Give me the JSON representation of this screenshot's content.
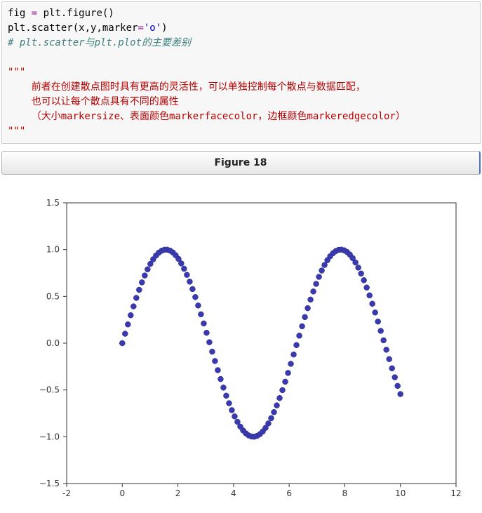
{
  "code": {
    "line1_var": "fig ",
    "line1_op": "=",
    "line1_rest": " plt.figure()",
    "line2_a": "plt.scatter(x,y,marker",
    "line2_op": "=",
    "line2_str": "'o'",
    "line2_close": ")",
    "line3_comment": "# plt.scatter与plt.plot的主要差别",
    "line4_quotes": "\"\"\"",
    "line5": "    前者在创建散点图时具有更高的灵活性，可以单独控制每个散点与数据匹配，",
    "line6": "    也可以让每个散点具有不同的属性",
    "line7": "    （大小markersize、表面颜色markerfacecolor，边框颜色markeredgecolor）",
    "line8_quotes": "\"\"\""
  },
  "figure_title": "Figure 18",
  "chart_data": {
    "type": "scatter",
    "x_start": 0,
    "x_end": 10,
    "n_points": 100,
    "function": "sin",
    "xlabel": "",
    "ylabel": "",
    "title": "",
    "xlim": [
      -2,
      12
    ],
    "ylim": [
      -1.5,
      1.5
    ],
    "xticks": [
      -2,
      0,
      2,
      4,
      6,
      8,
      10,
      12
    ],
    "yticks": [
      -1.5,
      -1.0,
      -0.5,
      0.0,
      0.5,
      1.0,
      1.5
    ],
    "marker": "o",
    "marker_color": "#3a3ab0"
  }
}
